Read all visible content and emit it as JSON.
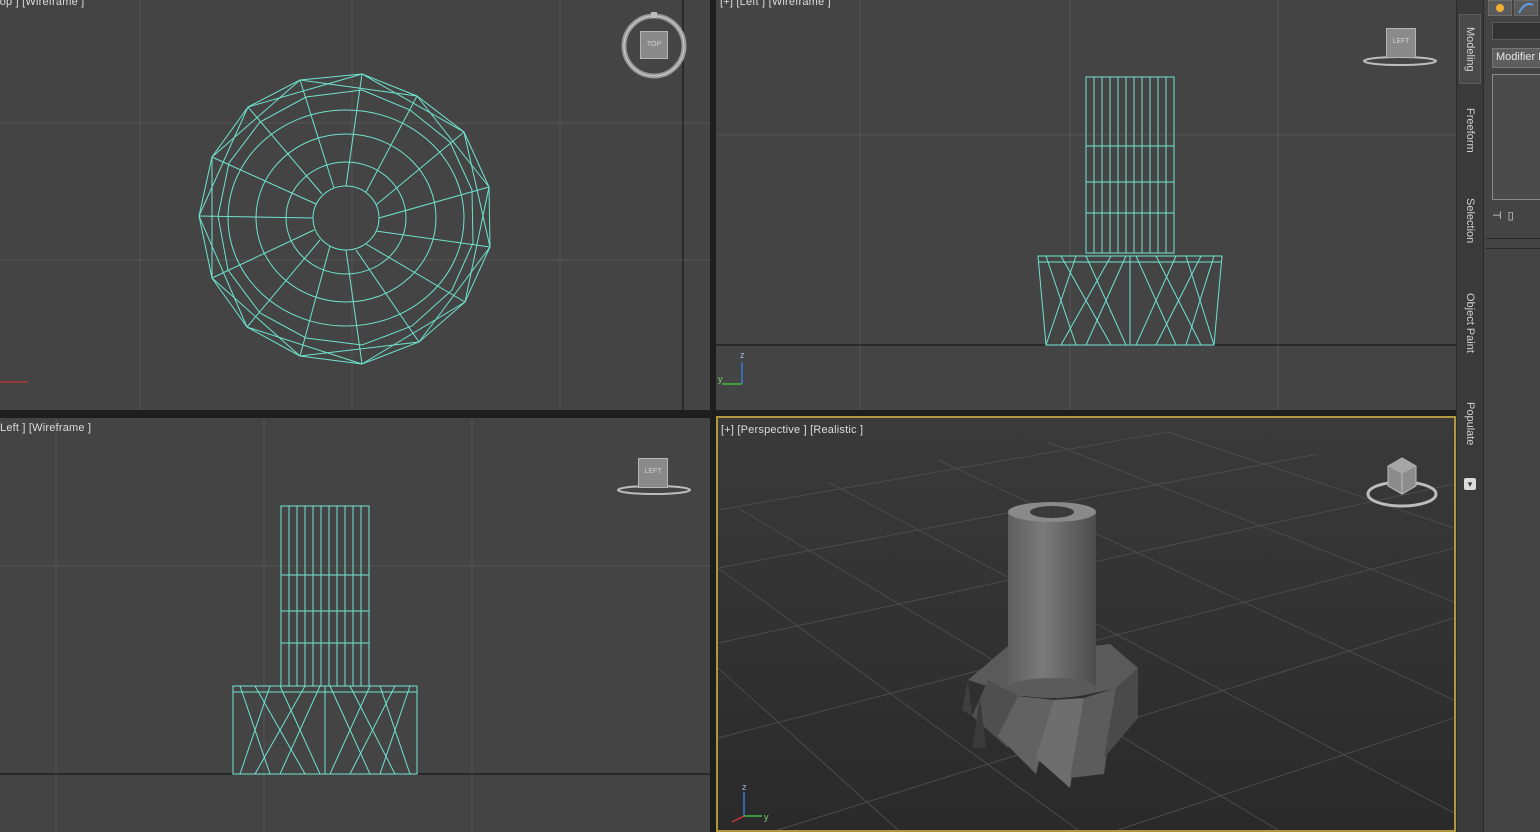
{
  "viewports": {
    "top": {
      "label": "Top ] [Wireframe ]",
      "cube_label": "TOP"
    },
    "left_upper": {
      "label": "[+] [Left ] [Wireframe ]",
      "cube_label": "LEFT"
    },
    "left_lower": {
      "label": "Left ] [Wireframe ]",
      "cube_label": "LEFT"
    },
    "perspective": {
      "label": "[+] [Perspective ] [Realistic ]"
    }
  },
  "axis_labels": {
    "y": "y",
    "z": "z"
  },
  "command_panel": {
    "tabs": [
      {
        "label": "Modeling"
      },
      {
        "label": "Freeform"
      },
      {
        "label": "Selection"
      },
      {
        "label": "Object Paint"
      },
      {
        "label": "Populate"
      }
    ],
    "modifier_list": "Modifier List"
  },
  "colors": {
    "viewport_bg": "#444444",
    "wireframe": "#6fe3cf",
    "active_border": "#b0963c",
    "perspective_bg": "#2c2c2c"
  }
}
